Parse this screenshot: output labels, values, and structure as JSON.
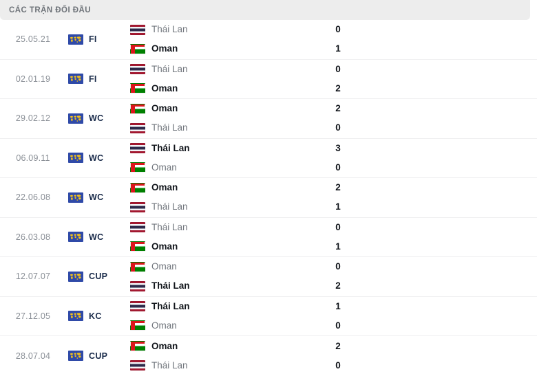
{
  "header": {
    "title": "CÁC TRẬN ĐỐI ĐẦU"
  },
  "colors": {
    "header_bg": "#ededed",
    "header_text": "#6d7278",
    "row_divider": "#f0f0f1",
    "date_text": "#8a8f96",
    "loser_text": "#70757c",
    "winner_text": "#11151b",
    "competition_text": "#1a2b4a",
    "comp_icon_bg": "#2f4aa8",
    "comp_icon_fg": "#f5c21b",
    "thailand_red": "#a51931",
    "thailand_blue": "#2d2a4a",
    "oman_red": "#db161b",
    "oman_green": "#008000"
  },
  "matches": [
    {
      "date": "25.05.21",
      "competition": "FI",
      "competition_icon": "fifa-world-map-icon",
      "home": {
        "name": "Thái Lan",
        "flag": "thailand-flag",
        "score": "0",
        "winner": false
      },
      "away": {
        "name": "Oman",
        "flag": "oman-flag",
        "score": "1",
        "winner": true
      }
    },
    {
      "date": "02.01.19",
      "competition": "FI",
      "competition_icon": "fifa-world-map-icon",
      "home": {
        "name": "Thái Lan",
        "flag": "thailand-flag",
        "score": "0",
        "winner": false
      },
      "away": {
        "name": "Oman",
        "flag": "oman-flag",
        "score": "2",
        "winner": true
      }
    },
    {
      "date": "29.02.12",
      "competition": "WC",
      "competition_icon": "fifa-world-map-icon",
      "home": {
        "name": "Oman",
        "flag": "oman-flag",
        "score": "2",
        "winner": true
      },
      "away": {
        "name": "Thái Lan",
        "flag": "thailand-flag",
        "score": "0",
        "winner": false
      }
    },
    {
      "date": "06.09.11",
      "competition": "WC",
      "competition_icon": "fifa-world-map-icon",
      "home": {
        "name": "Thái Lan",
        "flag": "thailand-flag",
        "score": "3",
        "winner": true
      },
      "away": {
        "name": "Oman",
        "flag": "oman-flag",
        "score": "0",
        "winner": false
      }
    },
    {
      "date": "22.06.08",
      "competition": "WC",
      "competition_icon": "fifa-world-map-icon",
      "home": {
        "name": "Oman",
        "flag": "oman-flag",
        "score": "2",
        "winner": true
      },
      "away": {
        "name": "Thái Lan",
        "flag": "thailand-flag",
        "score": "1",
        "winner": false
      }
    },
    {
      "date": "26.03.08",
      "competition": "WC",
      "competition_icon": "fifa-world-map-icon",
      "home": {
        "name": "Thái Lan",
        "flag": "thailand-flag",
        "score": "0",
        "winner": false
      },
      "away": {
        "name": "Oman",
        "flag": "oman-flag",
        "score": "1",
        "winner": true
      }
    },
    {
      "date": "12.07.07",
      "competition": "CUP",
      "competition_icon": "fifa-world-map-icon",
      "home": {
        "name": "Oman",
        "flag": "oman-flag",
        "score": "0",
        "winner": false
      },
      "away": {
        "name": "Thái Lan",
        "flag": "thailand-flag",
        "score": "2",
        "winner": true
      }
    },
    {
      "date": "27.12.05",
      "competition": "KC",
      "competition_icon": "fifa-world-map-icon",
      "home": {
        "name": "Thái Lan",
        "flag": "thailand-flag",
        "score": "1",
        "winner": true
      },
      "away": {
        "name": "Oman",
        "flag": "oman-flag",
        "score": "0",
        "winner": false
      }
    },
    {
      "date": "28.07.04",
      "competition": "CUP",
      "competition_icon": "fifa-world-map-icon",
      "home": {
        "name": "Oman",
        "flag": "oman-flag",
        "score": "2",
        "winner": true
      },
      "away": {
        "name": "Thái Lan",
        "flag": "thailand-flag",
        "score": "0",
        "winner": false
      }
    }
  ]
}
